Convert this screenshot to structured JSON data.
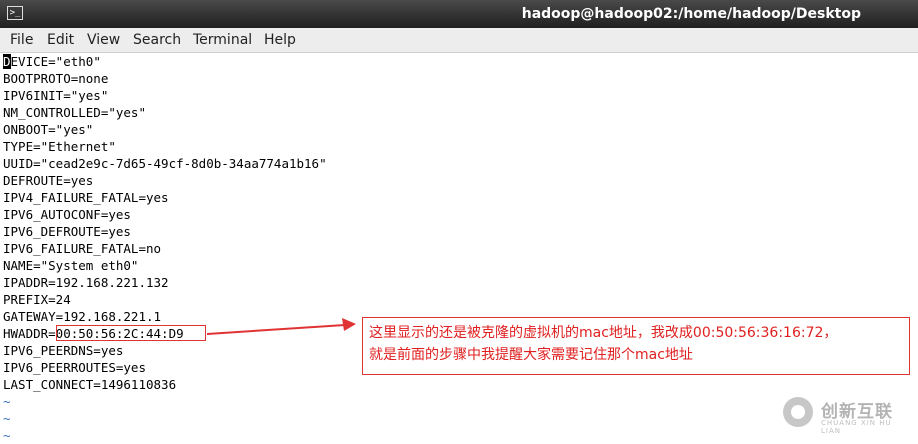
{
  "window": {
    "title": "hadoop@hadoop02:/home/hadoop/Desktop",
    "icon": "terminal-icon"
  },
  "menu": {
    "items": [
      {
        "label": "File"
      },
      {
        "label": "Edit"
      },
      {
        "label": "View"
      },
      {
        "label": "Search"
      },
      {
        "label": "Terminal"
      },
      {
        "label": "Help"
      }
    ]
  },
  "terminal": {
    "cursor_char": "D",
    "lines": [
      "EVICE=\"eth0\"",
      "BOOTPROTO=none",
      "IPV6INIT=\"yes\"",
      "NM_CONTROLLED=\"yes\"",
      "ONBOOT=\"yes\"",
      "TYPE=\"Ethernet\"",
      "UUID=\"cead2e9c-7d65-49cf-8d0b-34aa774a1b16\"",
      "DEFROUTE=yes",
      "IPV4_FAILURE_FATAL=yes",
      "IPV6_AUTOCONF=yes",
      "IPV6_DEFROUTE=yes",
      "IPV6_FAILURE_FATAL=no",
      "NAME=\"System eth0\"",
      "IPADDR=192.168.221.132",
      "PREFIX=24",
      "GATEWAY=192.168.221.1",
      "HWADDR=00:50:56:2C:44:D9",
      "IPV6_PEERDNS=yes",
      "IPV6_PEERROUTES=yes",
      "LAST_CONNECT=1496110836"
    ],
    "tilde": [
      "~",
      "~",
      "~"
    ]
  },
  "annotation": {
    "text_line1": "这里显示的还是被克隆的虚拟机的mac地址，我改成00:50:56:36:16:72，",
    "text_line2": "就是前面的步骤中我提醒大家需要记住那个mac地址",
    "color": "#e02020"
  },
  "watermark": {
    "text": "创新互联",
    "subtext": "CHUANG XIN HU LIAN"
  }
}
